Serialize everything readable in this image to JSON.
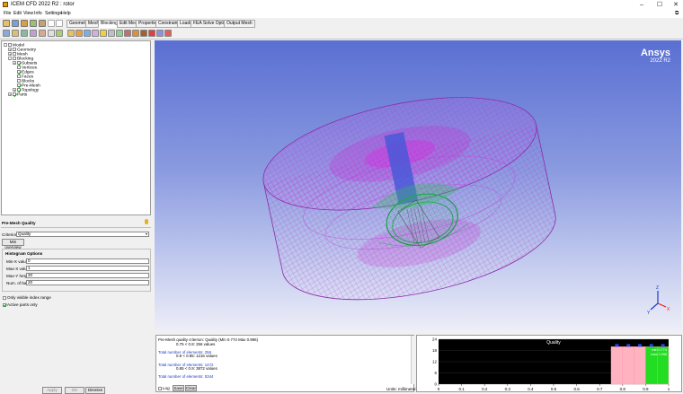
{
  "window": {
    "title": "ICEM CFD 2022 R2 : rotor"
  },
  "menu": [
    "File",
    "Edit",
    "View",
    "Info",
    "Settings",
    "Help"
  ],
  "tabs": [
    "Geometry",
    "Mesh",
    "Blocking",
    "Edit Mesh",
    "Properties",
    "Constraints",
    "Loads",
    "FEA Solve Options",
    "Output Mesh"
  ],
  "active_tab": "Blocking",
  "tree": [
    {
      "label": "Model",
      "level": 0,
      "checked": false,
      "expander": "-"
    },
    {
      "label": "Geometry",
      "level": 1,
      "checked": false,
      "expander": "+"
    },
    {
      "label": "Mesh",
      "level": 1,
      "checked": false,
      "expander": "+"
    },
    {
      "label": "Blocking",
      "level": 1,
      "checked": false,
      "expander": "-"
    },
    {
      "label": "Subsets",
      "level": 2,
      "checked": true,
      "expander": "+"
    },
    {
      "label": "Vertices",
      "level": 2,
      "checked": false,
      "expander": ""
    },
    {
      "label": "Edges",
      "level": 2,
      "checked": true,
      "expander": ""
    },
    {
      "label": "Faces",
      "level": 2,
      "checked": false,
      "expander": ""
    },
    {
      "label": "Blocks",
      "level": 2,
      "checked": false,
      "expander": ""
    },
    {
      "label": "Pre-Mesh",
      "level": 2,
      "checked": true,
      "expander": ""
    },
    {
      "label": "Topology",
      "level": 2,
      "checked": true,
      "expander": "+"
    },
    {
      "label": "Parts",
      "level": 1,
      "checked": true,
      "expander": "+"
    }
  ],
  "premesh": {
    "title": "Pre-Mesh Quality",
    "criterion_label": "Criterion",
    "criterion_value": "Quality",
    "min_overview_btn": "Min overview",
    "histogram_title": "Histogram Options",
    "fields": [
      {
        "label": "Min-X value",
        "value": "0"
      },
      {
        "label": "Max-X value",
        "value": "1"
      },
      {
        "label": "Max-Y height",
        "value": "20"
      },
      {
        "label": "Num. of bars",
        "value": "20"
      }
    ],
    "only_visible": {
      "label": "Only visible index range",
      "checked": false
    },
    "active_parts": {
      "label": "Active parts only",
      "checked": true
    },
    "buttons": [
      "Apply",
      "OK",
      "Dismiss"
    ]
  },
  "viewport": {
    "brand": "Ansys",
    "version": "2022 R2"
  },
  "messages": [
    {
      "text": "Pre-Mesh quality criterion: Quality (Min 0.774 Max 0.996)",
      "color": "#000000"
    },
    {
      "text": "0.75 < 0.8: 256 values",
      "color": "#000000",
      "indent": true
    },
    {
      "text": "",
      "color": "#000000"
    },
    {
      "text": "Total number of elements: 256",
      "color": "#1a3cc8"
    },
    {
      "text": "0.8 < 0.85: 1216 values",
      "color": "#000000",
      "indent": true
    },
    {
      "text": "",
      "color": "#000000"
    },
    {
      "text": "Total number of elements: 1472",
      "color": "#1a3cc8"
    },
    {
      "text": "0.85 < 0.9: 3872 values",
      "color": "#000000",
      "indent": true
    },
    {
      "text": "",
      "color": "#000000"
    },
    {
      "text": "Total number of elements: 5344",
      "color": "#1a3cc8"
    }
  ],
  "msg_controls": {
    "log": "Log",
    "save": "Save",
    "clear": "Clear",
    "units": "Units: millimeters"
  },
  "chart_data": {
    "type": "bar",
    "title": "Quality",
    "xlim": [
      0,
      1
    ],
    "ylim": [
      0,
      24
    ],
    "yticks": [
      0,
      6,
      12,
      18,
      24
    ],
    "xticks": [
      "0",
      "0.1",
      "0.2",
      "0.3",
      "0.4",
      "0.5",
      "0.6",
      "0.7",
      "0.8",
      "0.9",
      "1"
    ],
    "bars": [
      {
        "x0": 0.75,
        "x1": 0.8,
        "value": 20,
        "color": "#ffb3c0"
      },
      {
        "x0": 0.8,
        "x1": 0.85,
        "value": 20,
        "color": "#ffb3c0"
      },
      {
        "x0": 0.85,
        "x1": 0.9,
        "value": 20,
        "color": "#ffb3c0"
      },
      {
        "x0": 0.9,
        "x1": 0.95,
        "value": 20,
        "color": "#22dd22"
      },
      {
        "x0": 0.95,
        "x1": 1.0,
        "value": 20,
        "color": "#22dd22"
      }
    ],
    "min_label": "min 0.774",
    "max_label": "max 0.996"
  }
}
